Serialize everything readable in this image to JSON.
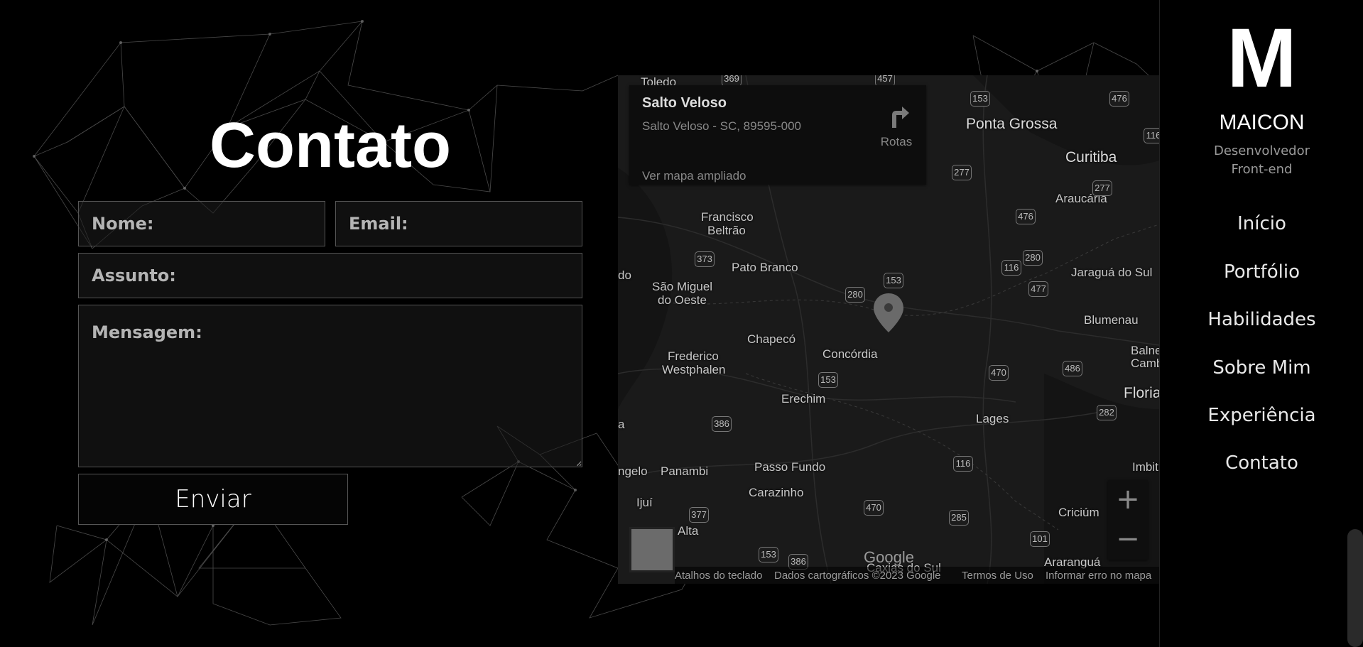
{
  "contact": {
    "title": "Contato",
    "name_placeholder": "Nome:",
    "email_placeholder": "Email:",
    "subject_placeholder": "Assunto:",
    "message_placeholder": "Mensagem:",
    "send_label": "Enviar"
  },
  "map": {
    "place_title": "Salto Veloso",
    "place_address": "Salto Veloso - SC, 89595-000",
    "directions_label": "Rotas",
    "view_larger_label": "Ver mapa ampliado",
    "zoom_in": "+",
    "zoom_out": "−",
    "google_logo": "Google",
    "footer": {
      "shortcuts": "Atalhos do teclado",
      "map_data": "Dados cartográficos ©2023 Google",
      "terms": "Termos de Uso",
      "report": "Informar erro no mapa"
    },
    "labels": [
      "Toledo",
      "Ponta Grossa",
      "Curitiba",
      "Araucária",
      "Francisco",
      "Beltrão",
      "Pato Branco",
      "São Miguel",
      "do Oeste",
      "Jaraguá do Sul",
      "Blumenau",
      "Chapecó",
      "Concórdia",
      "Frederico",
      "Westphalen",
      "Balne",
      "Camb",
      "Floria",
      "Erechim",
      "Lages",
      "Imbit",
      "Passo Fundo",
      "Panambi",
      "Carazinho",
      "Criciúm",
      "Araranguá",
      "Caxias do Sul",
      "ngelo",
      "Ijuí",
      "Alta",
      "do",
      "a"
    ],
    "shields": [
      "369",
      "457",
      "153",
      "476",
      "116",
      "277",
      "277",
      "476",
      "373",
      "280",
      "153",
      "116",
      "280",
      "477",
      "153",
      "470",
      "486",
      "386",
      "282",
      "116",
      "377",
      "470",
      "285",
      "101",
      "153",
      "386"
    ]
  },
  "sidebar": {
    "logo_mark": "M",
    "name": "MAICON",
    "role_line1": "Desenvolvedor",
    "role_line2": "Front-end",
    "nav": [
      "Início",
      "Portfólio",
      "Habilidades",
      "Sobre Mim",
      "Experiência",
      "Contato"
    ]
  }
}
